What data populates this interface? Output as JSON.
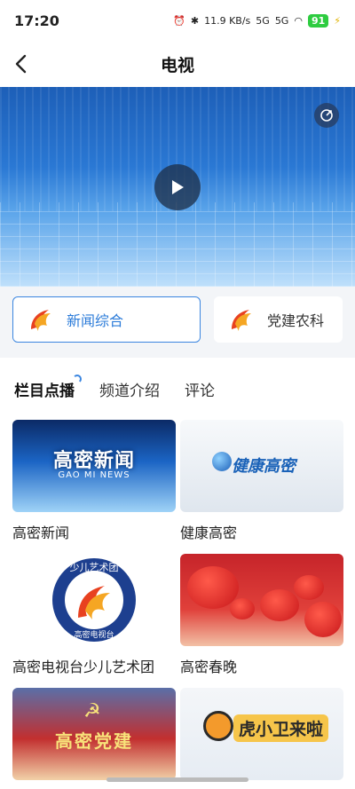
{
  "status_bar": {
    "time": "17:20",
    "net_speed": "11.9 KB/s",
    "signal1": "5G",
    "signal2": "5G",
    "battery": "91"
  },
  "header": {
    "title": "电视"
  },
  "player": {
    "play_label": "",
    "share_label": ""
  },
  "channels": [
    {
      "label": "新闻综合",
      "active": true
    },
    {
      "label": "党建农科",
      "active": false
    }
  ],
  "tabs": [
    {
      "label": "栏目点播",
      "active": true
    },
    {
      "label": "频道介绍",
      "active": false
    },
    {
      "label": "评论",
      "active": false
    }
  ],
  "programs": [
    {
      "title": "高密新闻",
      "thumb_text": "高密新闻",
      "thumb_sub": "GAO MI NEWS"
    },
    {
      "title": "健康高密",
      "thumb_text": "健康高密"
    },
    {
      "title": "高密电视台少儿艺术团",
      "logo_top": "少儿艺术团",
      "logo_bottom": "高密电视台"
    },
    {
      "title": "高密春晚"
    },
    {
      "title": "",
      "thumb_text": "高密党建"
    },
    {
      "title": "",
      "thumb_text": "虎小卫来啦"
    }
  ],
  "colors": {
    "accent": "#2b7bd9",
    "channel_bg": "#f3f5f8"
  }
}
